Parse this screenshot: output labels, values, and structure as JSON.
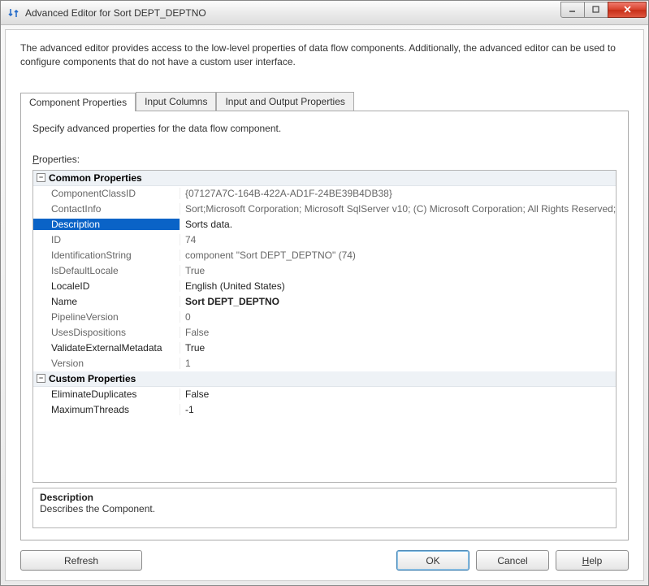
{
  "titlebar": {
    "title": "Advanced Editor for Sort DEPT_DEPTNO"
  },
  "intro": "The advanced editor provides access to the low-level properties of data flow components. Additionally, the advanced editor can be used to configure components that do not have a custom user interface.",
  "tabs": [
    {
      "label": "Component Properties"
    },
    {
      "label": "Input Columns"
    },
    {
      "label": "Input and Output Properties"
    }
  ],
  "panel": {
    "caption": "Specify advanced properties for the data flow component.",
    "propsLabel": "Properties:",
    "propsLabelFirst": "P",
    "propsLabelRest": "roperties:"
  },
  "grid": {
    "categories": [
      {
        "name": "Common Properties",
        "rows": [
          {
            "name": "ComponentClassID",
            "value": "{07127A7C-164B-422A-AD1F-24BE39B4DB38}",
            "readonly": true
          },
          {
            "name": "ContactInfo",
            "value": "Sort;Microsoft Corporation; Microsoft SqlServer v10; (C) Microsoft Corporation; All Rights Reserved; htt",
            "readonly": true
          },
          {
            "name": "Description",
            "value": "Sorts data.",
            "selected": true
          },
          {
            "name": "ID",
            "value": "74",
            "readonly": true
          },
          {
            "name": "IdentificationString",
            "value": "component \"Sort DEPT_DEPTNO\" (74)",
            "readonly": true
          },
          {
            "name": "IsDefaultLocale",
            "value": "True",
            "readonly": true
          },
          {
            "name": "LocaleID",
            "value": "English (United States)"
          },
          {
            "name": "Name",
            "value": "Sort DEPT_DEPTNO",
            "bold": true
          },
          {
            "name": "PipelineVersion",
            "value": "0",
            "readonly": true
          },
          {
            "name": "UsesDispositions",
            "value": "False",
            "readonly": true
          },
          {
            "name": "ValidateExternalMetadata",
            "value": "True"
          },
          {
            "name": "Version",
            "value": "1",
            "readonly": true
          }
        ]
      },
      {
        "name": "Custom Properties",
        "rows": [
          {
            "name": "EliminateDuplicates",
            "value": "False"
          },
          {
            "name": "MaximumThreads",
            "value": "-1"
          }
        ]
      }
    ]
  },
  "help": {
    "title": "Description",
    "desc": "Describes the Component."
  },
  "buttons": {
    "refresh": "Refresh",
    "ok": "OK",
    "cancel": "Cancel",
    "helpFirst": "H",
    "helpRest": "elp"
  }
}
